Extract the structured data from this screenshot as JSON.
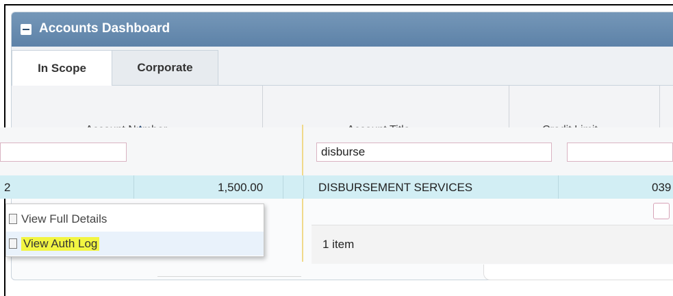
{
  "dashboard": {
    "title": "Accounts Dashboard",
    "tabs": [
      {
        "label": "In Scope",
        "active": true
      },
      {
        "label": "Corporate",
        "active": false
      }
    ],
    "headers": [
      "Account Number",
      "Account Title",
      "Credit Limit"
    ]
  },
  "filters": {
    "col2_value": "disburse"
  },
  "row": {
    "left_fragment": "2",
    "credit": "1,500.00",
    "title": "DISBURSEMENT SERVICES",
    "right_fragment": "039"
  },
  "context_menu": {
    "items": [
      "View Full Details",
      "View Auth Log"
    ]
  },
  "footer": {
    "count": "1 item"
  },
  "colors": {
    "titlebar": "#6a8db0",
    "row_highlight": "#d2eef4",
    "selection_highlight": "#f2f542"
  }
}
